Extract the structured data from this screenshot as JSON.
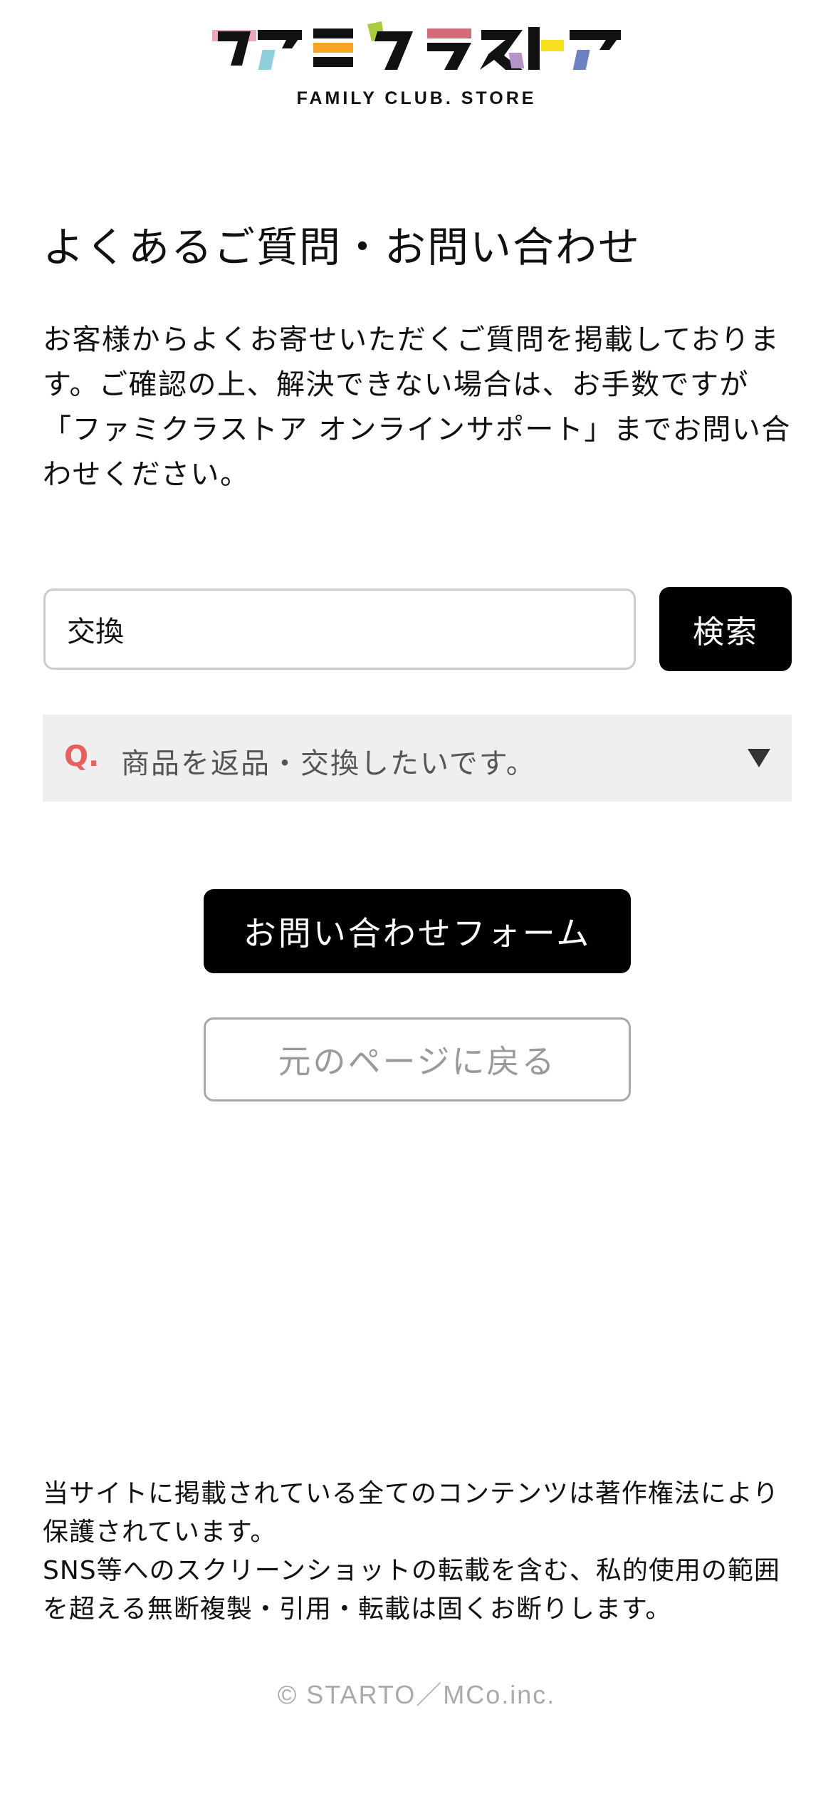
{
  "header": {
    "logo_text": "ファミクラストア",
    "logo_subtitle": "FAMILY CLUB. STORE",
    "logo_colors": [
      "#e8a8b9",
      "#8ecfdb",
      "#f6a623",
      "#a8cc3c",
      "#d46a7c",
      "#b493c8",
      "#f7e01d",
      "#6d82c0"
    ]
  },
  "page": {
    "title": "よくあるご質問・お問い合わせ",
    "intro": "お客様からよくお寄せいただくご質問を掲載しております。ご確認の上、解決できない場合は、お手数ですが 「ファミクラストア オンラインサポート」までお問い合わせください。"
  },
  "search": {
    "value": "交換",
    "button_label": "検索"
  },
  "faq": {
    "items": [
      {
        "marker": "Q.",
        "question": "商品を返品・交換したいです。",
        "icon": "caret-down-icon"
      }
    ]
  },
  "actions": {
    "contact_label": "お問い合わせフォーム",
    "back_label": "元のページに戻る"
  },
  "footer": {
    "notice_line1": "当サイトに掲載されている全てのコンテンツは著作権法により保護されています。",
    "notice_line2": "SNS等へのスクリーンショットの転載を含む、私的使用の範囲を超える無断複製・引用・転載は固くお断りします。",
    "copyright": "© STARTO／MCo.inc."
  },
  "colors": {
    "accent_q": "#e7605e",
    "button_bg": "#000000",
    "faq_bg": "#efefef"
  }
}
